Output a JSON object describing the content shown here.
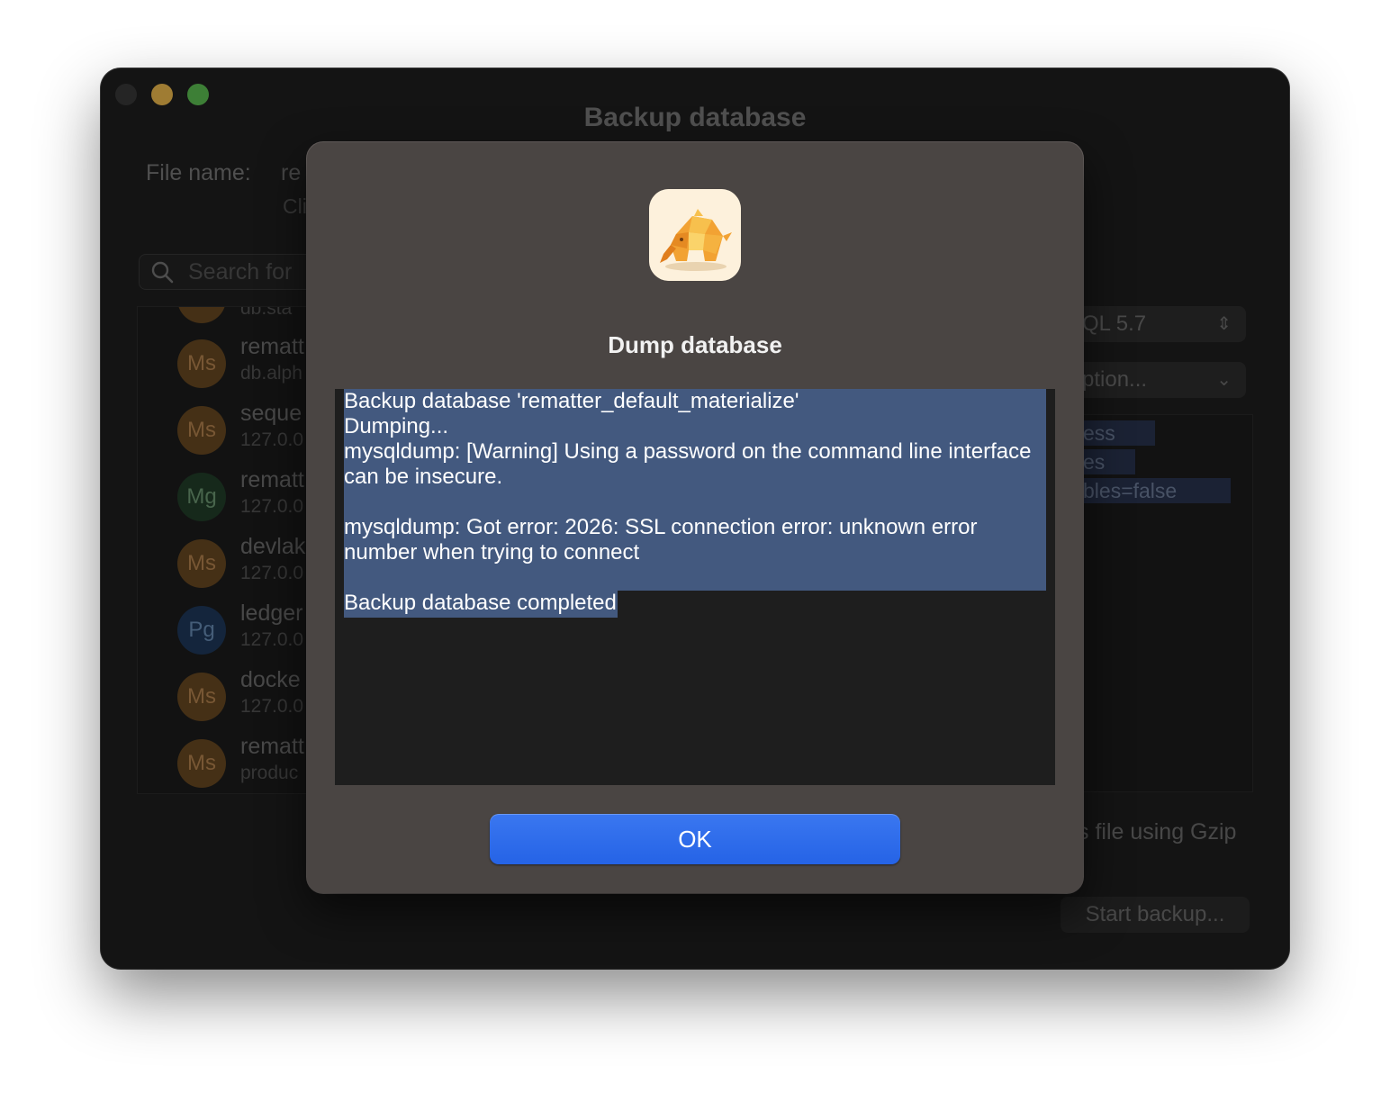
{
  "window": {
    "title": "Backup database"
  },
  "form": {
    "file_name_label": "File name:",
    "file_name_value": "re",
    "file_hint": "Cli"
  },
  "search": {
    "placeholder": "Search for"
  },
  "connections": [
    {
      "badge": "",
      "name": "",
      "host": "db.sta"
    },
    {
      "badge": "Ms",
      "name": "rematt",
      "host": "db.alph"
    },
    {
      "badge": "Ms",
      "name": "seque",
      "host": "127.0.0"
    },
    {
      "badge": "Mg",
      "name": "rematt",
      "host": "127.0.0"
    },
    {
      "badge": "Ms",
      "name": "devlak",
      "host": "127.0.0"
    },
    {
      "badge": "Pg",
      "name": "ledger",
      "host": "127.0.0"
    },
    {
      "badge": "Ms",
      "name": "docke",
      "host": "127.0.0"
    },
    {
      "badge": "Ms",
      "name": "rematt",
      "host": "produc"
    }
  ],
  "right_panel": {
    "version_select": "QL 5.7",
    "option_select": "ption...",
    "chips": [
      "ess",
      "es",
      "bles=false"
    ],
    "gzip_label": "s file using Gzip",
    "start_button": "Start backup..."
  },
  "dialog": {
    "title": "Dump database",
    "log_text": "Backup database 'rematter_default_materialize'\nDumping...\nmysqldump: [Warning] Using a password on the command line interface can be insecure.\n\nmysqldump: Got error: 2026: SSL connection error: unknown error number when trying to connect\n\nBackup database completed",
    "ok_button": "OK"
  },
  "colors": {
    "accent": "#2d6cea",
    "selection": "#43597f",
    "dialog_bg": "#4a4543"
  }
}
